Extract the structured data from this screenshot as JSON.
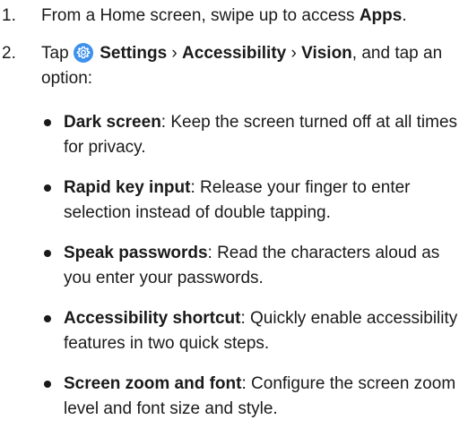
{
  "steps": [
    {
      "number": "1.",
      "text_before": "From a Home screen, swipe up to access ",
      "bold": "Apps",
      "text_after": "."
    },
    {
      "number": "2.",
      "tap": "Tap ",
      "icon": "settings-gear-icon",
      "settings": "Settings",
      "sep1": " › ",
      "accessibility": "Accessibility",
      "sep2": " › ",
      "vision": "Vision",
      "text_after": ", and tap an option:"
    }
  ],
  "options": [
    {
      "title": "Dark screen",
      "desc": ": Keep the screen turned off at all times for privacy."
    },
    {
      "title": "Rapid key input",
      "desc": ": Release your finger to enter selection instead of double tapping."
    },
    {
      "title": "Speak passwords",
      "desc": ": Read the characters aloud as you enter your passwords."
    },
    {
      "title": "Accessibility shortcut",
      "desc": ": Quickly enable accessibility features in two quick steps."
    },
    {
      "title": "Screen zoom and font",
      "desc": ": Configure the screen zoom level and font size and style."
    }
  ],
  "colors": {
    "text": "#1a1a1a",
    "icon_bg": "#3e91ec",
    "icon_fg": "#ffffff"
  }
}
